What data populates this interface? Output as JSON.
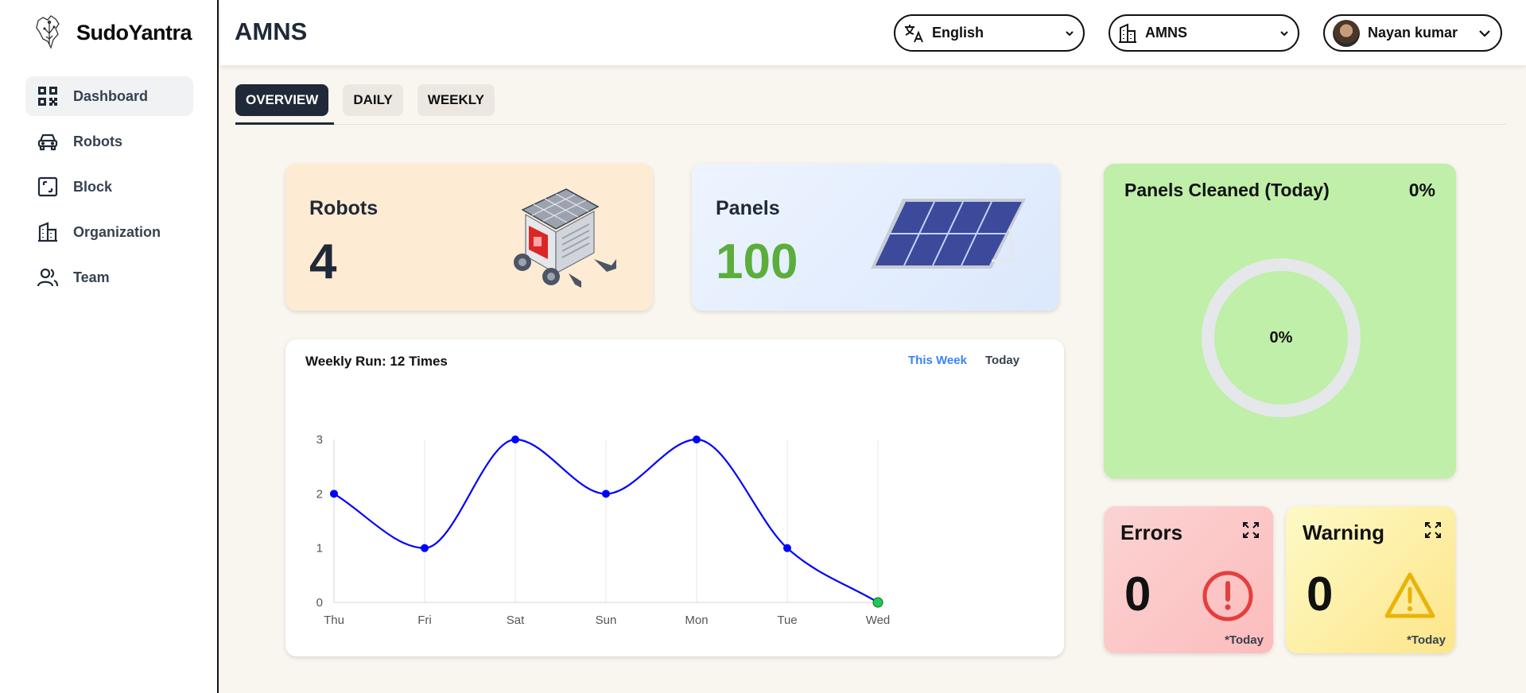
{
  "brand": {
    "name": "SudoYantra"
  },
  "sidebar": {
    "items": [
      {
        "label": "Dashboard",
        "icon": "qr-grid-icon",
        "active": true
      },
      {
        "label": "Robots",
        "icon": "car-icon"
      },
      {
        "label": "Block",
        "icon": "block-icon"
      },
      {
        "label": "Organization",
        "icon": "building-icon"
      },
      {
        "label": "Team",
        "icon": "team-icon"
      }
    ]
  },
  "header": {
    "title": "AMNS",
    "language": "English",
    "organization": "AMNS",
    "user": "Nayan kumar"
  },
  "tabs": [
    {
      "label": "OVERVIEW",
      "active": true
    },
    {
      "label": "DAILY"
    },
    {
      "label": "WEEKLY"
    }
  ],
  "cards": {
    "robots": {
      "label": "Robots",
      "value": "4"
    },
    "panels": {
      "label": "Panels",
      "value": "100"
    },
    "cleaned": {
      "title": "Panels Cleaned (Today)",
      "percent": "0%",
      "donut_label": "0%",
      "fraction": 0
    },
    "errors": {
      "title": "Errors",
      "value": "0",
      "note": "*Today"
    },
    "warning": {
      "title": "Warning",
      "value": "0",
      "note": "*Today"
    }
  },
  "weekly_chart": {
    "title": "Weekly Run: 12 Times",
    "toggle_week": "This Week",
    "toggle_today": "Today"
  },
  "colors": {
    "line": "#0000ff",
    "last_point": "#22c55e",
    "robots_bg": "#fdebd3",
    "cleaned_bg": "#bfefa8",
    "panels_value": "#5cae3c"
  },
  "chart_data": {
    "type": "line",
    "title": "Weekly Run: 12 Times",
    "categories": [
      "Thu",
      "Fri",
      "Sat",
      "Sun",
      "Mon",
      "Tue",
      "Wed"
    ],
    "values": [
      2,
      1,
      3,
      2,
      3,
      1,
      0
    ],
    "ylim": [
      0,
      3
    ],
    "yticks": [
      0,
      1,
      2,
      3
    ],
    "grid": "vertical",
    "smooth": true
  }
}
